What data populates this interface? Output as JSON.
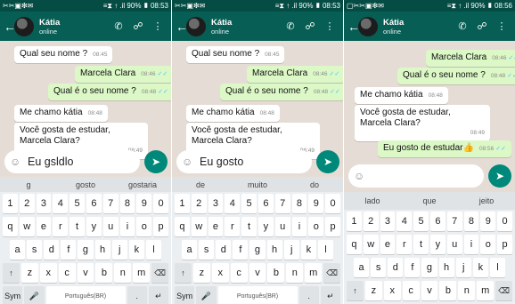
{
  "panels": [
    {
      "status": {
        "left": "✂✂▣❇✉",
        "right": "≡⧗ ↑ .il 90% ▮ 08:53"
      },
      "contact": {
        "name": "Kátia",
        "status": "online"
      },
      "messages": [
        {
          "text": "Qual seu nome ?",
          "time": "08:45",
          "ticks": ""
        },
        {
          "text": "Marcela Clara",
          "time": "08:46",
          "ticks": "✓✓"
        },
        {
          "text": "Qual  é o seu nome ?",
          "time": "08:48",
          "ticks": "✓✓"
        },
        {
          "text": "Me chamo kátia",
          "time": "08:48",
          "ticks": ""
        },
        {
          "text": "Você gosta de estudar, Marcela Clara?",
          "time": "08:49",
          "ticks": ""
        }
      ],
      "input": "Eu gsldlo",
      "suggestions": [
        "g",
        "gosto",
        "gostaria"
      ],
      "kb_rows": [
        [
          "1",
          "2",
          "3",
          "4",
          "5",
          "6",
          "7",
          "8",
          "9",
          "0"
        ],
        [
          "q",
          "w",
          "e",
          "r",
          "t",
          "y",
          "u",
          "i",
          "o",
          "p"
        ],
        [
          "a",
          "s",
          "d",
          "f",
          "g",
          "h",
          "j",
          "k",
          "l"
        ],
        [
          "↑",
          "z",
          "x",
          "c",
          "v",
          "b",
          "n",
          "m",
          "⌫"
        ],
        [
          "Sym",
          "🎤",
          "Português(BR)",
          ".",
          "↵"
        ]
      ]
    },
    {
      "status": {
        "left": "✂✂▣❇✉",
        "right": "≡⧗ ↑ .il 90% ▮ 08:53"
      },
      "contact": {
        "name": "Kátia",
        "status": "online"
      },
      "messages": [
        {
          "text": "Qual seu nome ?",
          "time": "08:45",
          "ticks": ""
        },
        {
          "text": "Marcela Clara",
          "time": "08:46",
          "ticks": "✓✓"
        },
        {
          "text": "Qual  é o seu nome ?",
          "time": "08:48",
          "ticks": "✓✓"
        },
        {
          "text": "Me chamo kátia",
          "time": "08:48",
          "ticks": ""
        },
        {
          "text": "Você gosta de estudar, Marcela Clara?",
          "time": "08:49",
          "ticks": ""
        }
      ],
      "input": "Eu gosto",
      "suggestions": [
        "de",
        "muito",
        "do"
      ],
      "kb_rows": [
        [
          "1",
          "2",
          "3",
          "4",
          "5",
          "6",
          "7",
          "8",
          "9",
          "0"
        ],
        [
          "q",
          "w",
          "e",
          "r",
          "t",
          "y",
          "u",
          "i",
          "o",
          "p"
        ],
        [
          "a",
          "s",
          "d",
          "f",
          "g",
          "h",
          "j",
          "k",
          "l"
        ],
        [
          "↑",
          "z",
          "x",
          "c",
          "v",
          "b",
          "n",
          "m",
          "⌫"
        ],
        [
          "Sym",
          "🎤",
          "Português(BR)",
          ".",
          "↵"
        ]
      ]
    },
    {
      "status": {
        "left": "▢✂✂▣❇✉",
        "right": "≡⧗ ↑ .il 90% ▮ 08:56"
      },
      "contact": {
        "name": "Kátia",
        "status": "online"
      },
      "messages": [
        {
          "text": "Marcela Clara",
          "time": "08:46",
          "ticks": "✓✓"
        },
        {
          "text": "Qual  é o seu nome ?",
          "time": "08:48",
          "ticks": "✓✓"
        },
        {
          "text": "Me chamo kátia",
          "time": "08:48",
          "ticks": ""
        },
        {
          "text": "Você gosta de estudar, Marcela Clara?",
          "time": "08:49",
          "ticks": ""
        },
        {
          "text": "Eu gosto de estudar👍",
          "time": "08:56",
          "ticks": "✓✓"
        }
      ],
      "input": "",
      "suggestions": [
        "lado",
        "que",
        "jeito"
      ],
      "kb_rows": [
        [
          "1",
          "2",
          "3",
          "4",
          "5",
          "6",
          "7",
          "8",
          "9",
          "0"
        ],
        [
          "q",
          "w",
          "e",
          "r",
          "t",
          "y",
          "u",
          "i",
          "o",
          "p"
        ],
        [
          "a",
          "s",
          "d",
          "f",
          "g",
          "h",
          "j",
          "k",
          "l"
        ],
        [
          "↑",
          "z",
          "x",
          "c",
          "v",
          "b",
          "n",
          "m",
          "⌫"
        ]
      ]
    }
  ]
}
